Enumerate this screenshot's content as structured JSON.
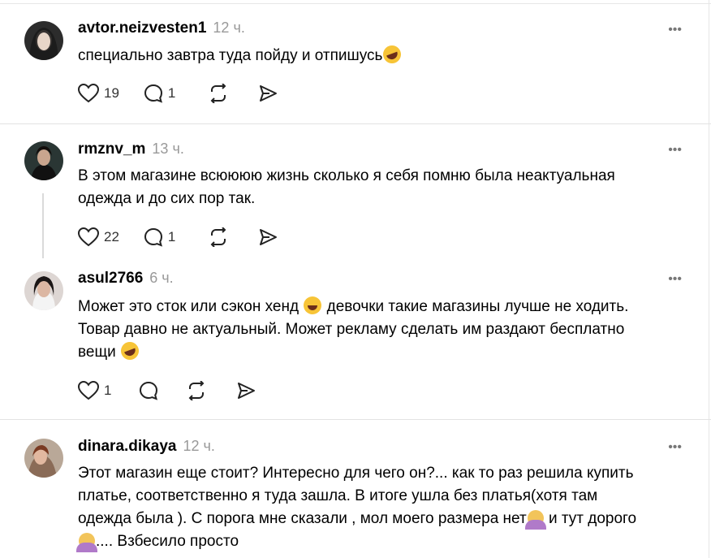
{
  "posts": [
    {
      "username": "avtor.neizvesten1",
      "time": "12 ч.",
      "text": "специально завтра туда пойду и отпишусь",
      "likes": "19",
      "replies": "1",
      "avatar_color": "#3a3a3a"
    },
    {
      "username": "rmznv_m",
      "time": "13 ч.",
      "text_line1": "В этом магазине всюююю жизнь сколько я себя помню была неактуальная",
      "text_line2": "одежда и до сих пор так.",
      "likes": "22",
      "replies": "1",
      "avatar_color": "#1f2b2a"
    },
    {
      "username": "asul2766",
      "time": "6 ч.",
      "text_line1_a": "Может это сток или сэкон хенд ",
      "text_line1_b": " девочки такие магазины лучше не ходить.",
      "text_line2": "Товар давно не актуальный. Может рекламу сделать им раздают бесплатно",
      "text_line3": "вещи ",
      "likes": "1",
      "avatar_color": "#c8c2c0"
    },
    {
      "username": "dinara.dikaya",
      "time": "12 ч.",
      "text_line1": "Этот магазин еще стоит? Интересно для чего он?... как то раз решила купить",
      "text_line2": "платье, соответственно я туда зашла. В итоге ушла без платья(хотя там",
      "text_line3_a": "одежда была ). С порога мне сказали , мол моего размера нет",
      "text_line3_b": " и тут дорого",
      "text_line4": ".... Взбесило просто",
      "avatar_color": "#a08a7a"
    }
  ],
  "more_glyph": "•••",
  "icons": [
    "heart-icon",
    "comment-icon",
    "repost-icon",
    "share-icon",
    "more-icon"
  ]
}
